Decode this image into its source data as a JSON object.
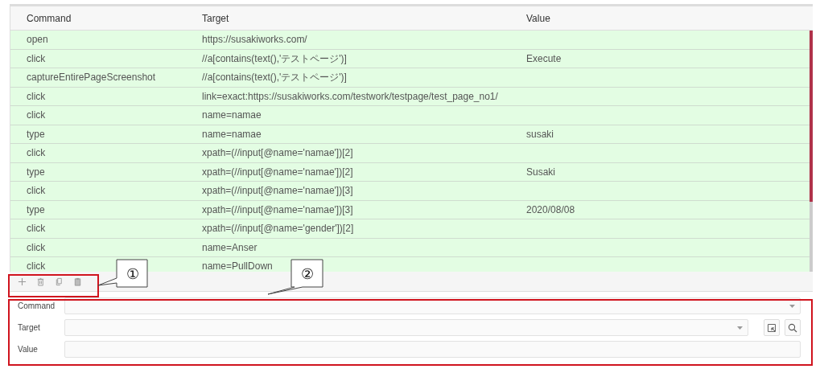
{
  "table": {
    "columns": [
      "Command",
      "Target",
      "Value"
    ],
    "rows": [
      {
        "command": "open",
        "target": "https://susakiworks.com/",
        "value": ""
      },
      {
        "command": "click",
        "target": "//a[contains(text(),'テストページ')]",
        "value": "Execute"
      },
      {
        "command": "captureEntirePageScreenshot",
        "target": "//a[contains(text(),'テストページ')]",
        "value": ""
      },
      {
        "command": "click",
        "target": "link=exact:https://susakiworks.com/testwork/testpage/test_page_no1/",
        "value": ""
      },
      {
        "command": "click",
        "target": "name=namae",
        "value": ""
      },
      {
        "command": "type",
        "target": "name=namae",
        "value": "susaki"
      },
      {
        "command": "click",
        "target": "xpath=(//input[@name='namae'])[2]",
        "value": ""
      },
      {
        "command": "type",
        "target": "xpath=(//input[@name='namae'])[2]",
        "value": "Susaki"
      },
      {
        "command": "click",
        "target": "xpath=(//input[@name='namae'])[3]",
        "value": ""
      },
      {
        "command": "type",
        "target": "xpath=(//input[@name='namae'])[3]",
        "value": "2020/08/08"
      },
      {
        "command": "click",
        "target": "xpath=(//input[@name='gender'])[2]",
        "value": ""
      },
      {
        "command": "click",
        "target": "name=Anser",
        "value": ""
      },
      {
        "command": "click",
        "target": "name=PullDown",
        "value": ""
      }
    ]
  },
  "toolbar": [
    {
      "kind": "add"
    },
    {
      "kind": "delete"
    },
    {
      "kind": "copy"
    },
    {
      "kind": "paste"
    }
  ],
  "editor": [
    {
      "label": "Command",
      "kind": "select"
    },
    {
      "label": "Target",
      "kind": "select-tools"
    },
    {
      "label": "Value",
      "kind": "text"
    }
  ],
  "annotations": [
    {
      "label": "①"
    },
    {
      "label": "②"
    }
  ]
}
